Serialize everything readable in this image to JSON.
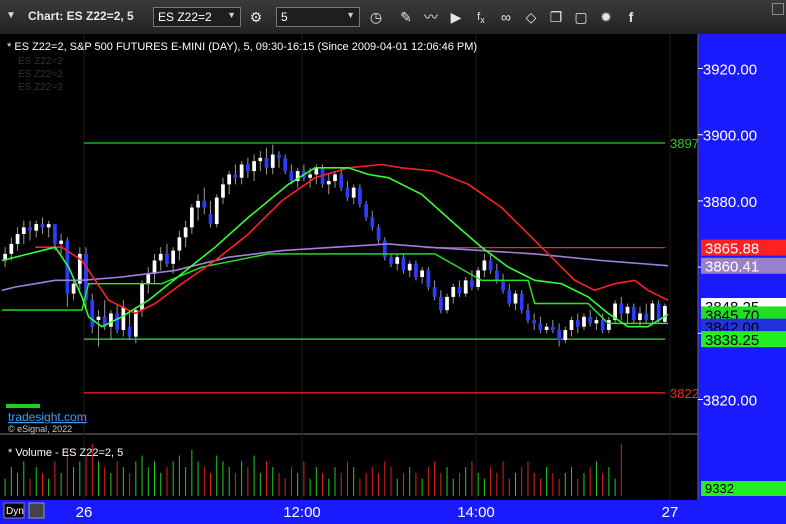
{
  "window": {
    "title": "Chart: ES Z22=2, 5"
  },
  "toolbar": {
    "symbol_value": "ES Z22=2",
    "interval_value": "5",
    "icons": [
      "settings-icon",
      "clock-icon",
      "draw-icon",
      "study-icon",
      "play-icon",
      "fx-icon",
      "link-icon",
      "eraser-icon",
      "copy-icon",
      "color-palette-icon",
      "facebook-icon"
    ]
  },
  "chart": {
    "header": "* ES Z22=2, S&P 500 FUTURES E-MINI (DAY), 5, 09:30-16:15 (Since 2009-04-01 12:06:46 PM)",
    "legend_items": [
      "ES Z22=2",
      "ES Z22=2",
      "ES Z22=2"
    ],
    "watermark": "tradesight.com",
    "copyright": "© eSignal, 2022",
    "price_axis_labels": [
      "3920.00",
      "3900.00",
      "3880.00",
      "3860.00",
      "3840.00",
      "3820.00"
    ],
    "price_tags": [
      {
        "label": "3865.88",
        "color": "#ff2020",
        "text_color": "#ffffff",
        "price": 3865.88
      },
      {
        "label": "3860.41",
        "color": "#9a80c8",
        "text_color": "#ffffff",
        "price": 3860.41
      },
      {
        "label": "3848.25",
        "color": "#ffffff",
        "text_color": "#000000",
        "price": 3848.25
      },
      {
        "label": "3845.70",
        "color": "#22dd22",
        "text_color": "#000000",
        "price": 3845.7
      },
      {
        "label": "3842.00",
        "color": "#2233dd",
        "text_color": "#000000",
        "price": 3842.0
      },
      {
        "label": "3838.25",
        "color": "#22ee22",
        "text_color": "#000000",
        "price": 3838.25
      }
    ],
    "right_edge_labels": [
      {
        "label": "3897",
        "color": "#22cc22",
        "price": 3897.5
      },
      {
        "label": "3822",
        "color": "#ff2020",
        "price": 3822
      }
    ],
    "volume_title": "* Volume - ES Z22=2, 5",
    "volume_tag": "9332",
    "bottom_left": "Dyn",
    "time_labels": [
      "26",
      "12:00",
      "14:00",
      "27"
    ]
  },
  "chart_data": {
    "type": "candlestick",
    "ylim": [
      3812,
      3928
    ],
    "horizontal_levels": [
      {
        "price": 3897.5,
        "color": "#22cc22"
      },
      {
        "price": 3838.25,
        "color": "#22ee22"
      },
      {
        "price": 3822,
        "color": "#ff2020"
      },
      {
        "price": 3865.88,
        "color": "#ff2020"
      }
    ],
    "candles": [
      [
        3862,
        3866,
        3860,
        3864
      ],
      [
        3864,
        3869,
        3862,
        3867
      ],
      [
        3867,
        3872,
        3865,
        3870
      ],
      [
        3870,
        3874,
        3867,
        3872
      ],
      [
        3872,
        3874,
        3868,
        3871
      ],
      [
        3871,
        3874,
        3869,
        3873
      ],
      [
        3873,
        3875,
        3870,
        3872
      ],
      [
        3872,
        3874,
        3869,
        3873
      ],
      [
        3873,
        3873,
        3865,
        3867
      ],
      [
        3867,
        3870,
        3864,
        3868
      ],
      [
        3868,
        3869,
        3848,
        3852
      ],
      [
        3852,
        3856,
        3850,
        3855
      ],
      [
        3855,
        3866,
        3853,
        3864
      ],
      [
        3864,
        3866,
        3848,
        3850
      ],
      [
        3850,
        3852,
        3840,
        3842
      ],
      [
        3844,
        3847,
        3836,
        3845
      ],
      [
        3845,
        3850,
        3841,
        3842
      ],
      [
        3842,
        3847,
        3838,
        3846
      ],
      [
        3846,
        3849,
        3840,
        3841
      ],
      [
        3841,
        3850,
        3839,
        3848
      ],
      [
        3842,
        3847,
        3838,
        3839
      ],
      [
        3839,
        3848,
        3837,
        3847
      ],
      [
        3847,
        3856,
        3845,
        3855
      ],
      [
        3855,
        3860,
        3852,
        3858
      ],
      [
        3858,
        3864,
        3855,
        3862
      ],
      [
        3862,
        3866,
        3859,
        3864
      ],
      [
        3864,
        3867,
        3860,
        3861
      ],
      [
        3861,
        3866,
        3858,
        3865
      ],
      [
        3865,
        3871,
        3862,
        3869
      ],
      [
        3869,
        3874,
        3866,
        3872
      ],
      [
        3872,
        3879,
        3870,
        3878
      ],
      [
        3878,
        3882,
        3874,
        3880
      ],
      [
        3880,
        3884,
        3876,
        3878
      ],
      [
        3876,
        3880,
        3872,
        3873
      ],
      [
        3873,
        3882,
        3872,
        3881
      ],
      [
        3881,
        3887,
        3879,
        3885
      ],
      [
        3885,
        3889,
        3882,
        3888
      ],
      [
        3888,
        3891,
        3885,
        3887
      ],
      [
        3887,
        3892,
        3885,
        3891
      ],
      [
        3891,
        3893,
        3887,
        3889
      ],
      [
        3889,
        3894,
        3886,
        3892
      ],
      [
        3892,
        3895,
        3889,
        3893
      ],
      [
        3893,
        3896,
        3888,
        3890
      ],
      [
        3890,
        3897,
        3888,
        3894
      ],
      [
        3894,
        3895,
        3890,
        3893
      ],
      [
        3893,
        3894,
        3888,
        3889
      ],
      [
        3889,
        3891,
        3885,
        3886
      ],
      [
        3886,
        3890,
        3884,
        3889
      ],
      [
        3889,
        3891,
        3886,
        3887
      ],
      [
        3887,
        3890,
        3884,
        3888
      ],
      [
        3888,
        3891,
        3885,
        3890
      ],
      [
        3890,
        3891,
        3884,
        3885
      ],
      [
        3885,
        3888,
        3882,
        3886
      ],
      [
        3886,
        3889,
        3884,
        3888
      ],
      [
        3888,
        3890,
        3883,
        3884
      ],
      [
        3884,
        3886,
        3880,
        3881
      ],
      [
        3881,
        3885,
        3879,
        3884
      ],
      [
        3884,
        3885,
        3878,
        3879
      ],
      [
        3879,
        3880,
        3874,
        3875
      ],
      [
        3875,
        3877,
        3871,
        3872
      ],
      [
        3872,
        3873,
        3867,
        3868
      ],
      [
        3868,
        3869,
        3862,
        3863
      ],
      [
        3863,
        3864,
        3860,
        3861
      ],
      [
        3861,
        3864,
        3859,
        3863
      ],
      [
        3863,
        3864,
        3858,
        3859
      ],
      [
        3859,
        3862,
        3857,
        3861
      ],
      [
        3861,
        3862,
        3856,
        3857
      ],
      [
        3857,
        3860,
        3855,
        3859
      ],
      [
        3859,
        3860,
        3853,
        3854
      ],
      [
        3854,
        3856,
        3850,
        3851
      ],
      [
        3851,
        3853,
        3846,
        3847
      ],
      [
        3847,
        3852,
        3846,
        3851
      ],
      [
        3851,
        3855,
        3849,
        3854
      ],
      [
        3854,
        3856,
        3851,
        3852
      ],
      [
        3852,
        3857,
        3851,
        3856
      ],
      [
        3856,
        3859,
        3853,
        3854
      ],
      [
        3854,
        3860,
        3853,
        3859
      ],
      [
        3859,
        3864,
        3857,
        3862
      ],
      [
        3862,
        3864,
        3858,
        3859
      ],
      [
        3859,
        3861,
        3855,
        3856
      ],
      [
        3856,
        3858,
        3852,
        3853
      ],
      [
        3853,
        3855,
        3848,
        3849
      ],
      [
        3849,
        3853,
        3847,
        3852
      ],
      [
        3852,
        3853,
        3846,
        3847
      ],
      [
        3847,
        3849,
        3843,
        3844
      ],
      [
        3844,
        3846,
        3841,
        3843
      ],
      [
        3843,
        3845,
        3840,
        3841
      ],
      [
        3841,
        3843,
        3840,
        3842
      ],
      [
        3842,
        3844,
        3840,
        3841
      ],
      [
        3841,
        3843,
        3836,
        3838
      ],
      [
        3838,
        3842,
        3837,
        3841
      ],
      [
        3841,
        3845,
        3839,
        3844
      ],
      [
        3844,
        3846,
        3840,
        3842
      ],
      [
        3842,
        3846,
        3841,
        3845
      ],
      [
        3845,
        3847,
        3842,
        3843
      ],
      [
        3843,
        3845,
        3841,
        3844
      ],
      [
        3844,
        3846,
        3840,
        3841
      ],
      [
        3841,
        3845,
        3840,
        3844
      ],
      [
        3844,
        3850,
        3843,
        3849
      ],
      [
        3849,
        3851,
        3844,
        3846
      ],
      [
        3846,
        3849,
        3843,
        3848
      ],
      [
        3848,
        3849,
        3843,
        3844
      ],
      [
        3844,
        3848,
        3842,
        3846
      ],
      [
        3846,
        3849,
        3843,
        3844
      ],
      [
        3844,
        3850,
        3843,
        3849
      ],
      [
        3849,
        3850,
        3843,
        3843.5
      ],
      [
        3843.5,
        3849,
        3843,
        3848.25
      ]
    ],
    "vwap_line": [
      [
        0,
        3853
      ],
      [
        0.02,
        3854
      ],
      [
        0.05,
        3855
      ],
      [
        0.08,
        3856
      ],
      [
        0.12,
        3856
      ],
      [
        0.18,
        3857
      ],
      [
        0.26,
        3859
      ],
      [
        0.34,
        3863
      ],
      [
        0.42,
        3865
      ],
      [
        0.5,
        3866
      ],
      [
        0.58,
        3867
      ],
      [
        0.64,
        3866
      ],
      [
        0.72,
        3865
      ],
      [
        0.8,
        3864
      ],
      [
        0.9,
        3862
      ],
      [
        1,
        3860.41
      ]
    ],
    "red_avg_line": [
      [
        0.05,
        3866
      ],
      [
        0.09,
        3866
      ],
      [
        0.12,
        3862
      ],
      [
        0.14,
        3856
      ],
      [
        0.16,
        3850
      ],
      [
        0.18,
        3848
      ],
      [
        0.2,
        3846
      ],
      [
        0.23,
        3849
      ],
      [
        0.27,
        3855
      ],
      [
        0.32,
        3862
      ],
      [
        0.37,
        3870
      ],
      [
        0.42,
        3880
      ],
      [
        0.47,
        3887
      ],
      [
        0.52,
        3890
      ],
      [
        0.57,
        3891
      ],
      [
        0.6,
        3890
      ],
      [
        0.65,
        3889
      ],
      [
        0.7,
        3885
      ],
      [
        0.75,
        3878
      ],
      [
        0.8,
        3868
      ],
      [
        0.84,
        3860
      ],
      [
        0.86,
        3856
      ],
      [
        0.89,
        3853
      ],
      [
        0.92,
        3855
      ],
      [
        0.95,
        3856
      ],
      [
        0.97,
        3853
      ],
      [
        1,
        3850
      ]
    ],
    "green_avg_line": [
      [
        0,
        3862
      ],
      [
        0.04,
        3864
      ],
      [
        0.08,
        3866
      ],
      [
        0.1,
        3860
      ],
      [
        0.12,
        3851
      ],
      [
        0.13,
        3845
      ],
      [
        0.15,
        3842
      ],
      [
        0.18,
        3845
      ],
      [
        0.22,
        3850
      ],
      [
        0.27,
        3858
      ],
      [
        0.32,
        3866
      ],
      [
        0.37,
        3875
      ],
      [
        0.43,
        3885
      ],
      [
        0.47,
        3890
      ],
      [
        0.52,
        3890
      ],
      [
        0.55,
        3888
      ],
      [
        0.58,
        3887
      ],
      [
        0.63,
        3882
      ],
      [
        0.68,
        3873
      ],
      [
        0.72,
        3866
      ],
      [
        0.76,
        3860
      ],
      [
        0.8,
        3856
      ],
      [
        0.84,
        3855
      ],
      [
        0.88,
        3851
      ],
      [
        0.91,
        3846
      ],
      [
        0.94,
        3842
      ],
      [
        0.97,
        3842
      ],
      [
        1,
        3845.7
      ]
    ],
    "green_step_line": [
      [
        0,
        3847
      ],
      [
        0.1,
        3847
      ],
      [
        0.12,
        3847
      ],
      [
        0.13,
        3855
      ],
      [
        0.24,
        3855
      ],
      [
        0.3,
        3860
      ],
      [
        0.4,
        3864
      ],
      [
        0.5,
        3864
      ],
      [
        0.6,
        3864
      ],
      [
        0.65,
        3864
      ],
      [
        0.72,
        3856
      ],
      [
        0.79,
        3856
      ],
      [
        0.8,
        3849
      ],
      [
        0.88,
        3849
      ],
      [
        0.91,
        3843
      ],
      [
        1,
        3843
      ]
    ],
    "volume": [
      3,
      5,
      4,
      6,
      3,
      5,
      4,
      3,
      6,
      4,
      8,
      5,
      6,
      7,
      9,
      6,
      5,
      4,
      6,
      5,
      4,
      6,
      7,
      5,
      6,
      4,
      5,
      6,
      7,
      5,
      8,
      6,
      5,
      4,
      7,
      6,
      5,
      4,
      6,
      5,
      7,
      4,
      6,
      5,
      4,
      3,
      5,
      4,
      6,
      3,
      5,
      4,
      3,
      5,
      4,
      6,
      5,
      3,
      4,
      5,
      4,
      6,
      5,
      3,
      4,
      5,
      4,
      3,
      5,
      6,
      4,
      5,
      3,
      4,
      5,
      6,
      4,
      3,
      5,
      4,
      6,
      3,
      4,
      5,
      6,
      4,
      3,
      5,
      4,
      3,
      4,
      5,
      3,
      4,
      5,
      6,
      4,
      5,
      3,
      9
    ]
  }
}
